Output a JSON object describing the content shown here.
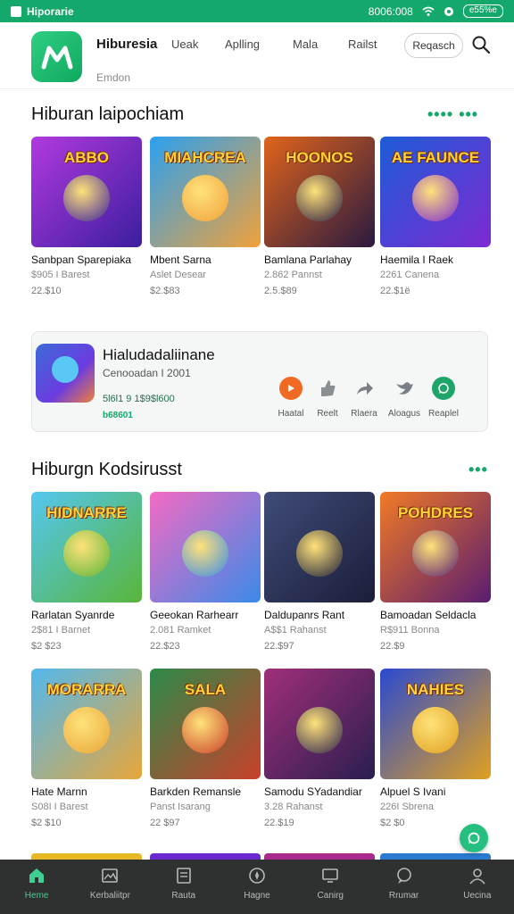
{
  "status_bar": {
    "app_name": "Hiporarie",
    "time": "8006:008",
    "battery": "e55%e"
  },
  "header": {
    "brand": "Hiburesia",
    "sub_brand": "Emdon",
    "nav": [
      "Ueak",
      "Aplling",
      "Mala",
      "Railst"
    ],
    "search_label": "Reqasch"
  },
  "section1": {
    "title": "Hiburan laipochiam",
    "more": "•••• •••",
    "games": [
      {
        "name": "Sanbpan Sparepiaka",
        "meta": "$905 I Barest",
        "price": "22.$10",
        "thumb_title": "ABBO",
        "colors": [
          "#b13adf",
          "#3c1e9e"
        ]
      },
      {
        "name": "Mbent Sarna",
        "meta": "Aslet Desear",
        "price": "$2.$83",
        "thumb_title": "MIAHCREA",
        "colors": [
          "#2aa0f0",
          "#f0a13b"
        ]
      },
      {
        "name": "Bamlana Parlahay",
        "meta": "2.862 Pannst",
        "price": "2.5.$89",
        "thumb_title": "HOONOS",
        "colors": [
          "#e0641c",
          "#2a1a40"
        ]
      },
      {
        "name": "Haemila I Raek",
        "meta": "2261 Canena",
        "price": "22.$1ë",
        "thumb_title": "AE FAUNCE",
        "colors": [
          "#1d5cd6",
          "#7d2ad2"
        ]
      }
    ]
  },
  "featured": {
    "title": "Hialudadaliinane",
    "subtitle": "Cenooadan I 2001",
    "stats": "5l6l1 9 1$9$l600",
    "badge": "b68601",
    "actions": [
      {
        "label": "Haatal",
        "icon": "play-icon"
      },
      {
        "label": "Reelt",
        "icon": "like-icon"
      },
      {
        "label": "Rlaera",
        "icon": "share-icon"
      },
      {
        "label": "Aloagus",
        "icon": "bird-icon"
      },
      {
        "label": "Reaplel",
        "icon": "chat-icon"
      }
    ]
  },
  "section2": {
    "title": "Hiburgn Kodsirusst",
    "more": "•••",
    "games": [
      {
        "name": "Rarlatan Syanrde",
        "meta": "2$81 I Barnet",
        "price": "$2 $23",
        "thumb_title": "HIDNARRE",
        "colors": [
          "#54c7f0",
          "#58b53a"
        ]
      },
      {
        "name": "Geeokan Rarhearr",
        "meta": "2.081 Ramket",
        "price": "22.$23",
        "thumb_title": "",
        "colors": [
          "#f46ac3",
          "#3a8ae8"
        ]
      },
      {
        "name": "Daldupanrs Rant",
        "meta": "A$$1 Rahanst",
        "price": "22.$97",
        "thumb_title": "",
        "colors": [
          "#3f4c78",
          "#1b1e3a"
        ]
      },
      {
        "name": "Bamoadan Seldacla",
        "meta": "R$911 Bonna",
        "price": "22.$9",
        "thumb_title": "POHDRES",
        "colors": [
          "#f07a25",
          "#5a1c70"
        ]
      }
    ]
  },
  "section3": {
    "games": [
      {
        "name": "Hate Marnn",
        "meta": "S08I I Barest",
        "price": "$2 $10",
        "thumb_title": "MORARRA",
        "colors": [
          "#52b8ee",
          "#e8a63a"
        ]
      },
      {
        "name": "Barkden Remansle",
        "meta": "Panst Isarang",
        "price": "22 $97",
        "thumb_title": "SALA",
        "colors": [
          "#2c8a4a",
          "#c9402a"
        ]
      },
      {
        "name": "Samodu SYadandiar",
        "meta": "3.28 Rahanst",
        "price": "22.$19",
        "thumb_title": "",
        "colors": [
          "#a02f7a",
          "#2a1e4e"
        ]
      },
      {
        "name": "Alpuel S Ivani",
        "meta": "226I Sbrena",
        "price": "$2 $0",
        "thumb_title": "NAHIES",
        "colors": [
          "#2a4ad0",
          "#e0a020"
        ]
      }
    ]
  },
  "bottom_nav": [
    {
      "label": "Heme",
      "icon": "home-icon",
      "active": true
    },
    {
      "label": "Kerbaliitpr",
      "icon": "gallery-icon",
      "active": false
    },
    {
      "label": "Rauta",
      "icon": "list-icon",
      "active": false
    },
    {
      "label": "Hagne",
      "icon": "compass-icon",
      "active": false
    },
    {
      "label": "Canirg",
      "icon": "monitor-icon",
      "active": false
    },
    {
      "label": "Rrumar",
      "icon": "chat-icon",
      "active": false
    },
    {
      "label": "Uecina",
      "icon": "user-icon",
      "active": false
    }
  ]
}
